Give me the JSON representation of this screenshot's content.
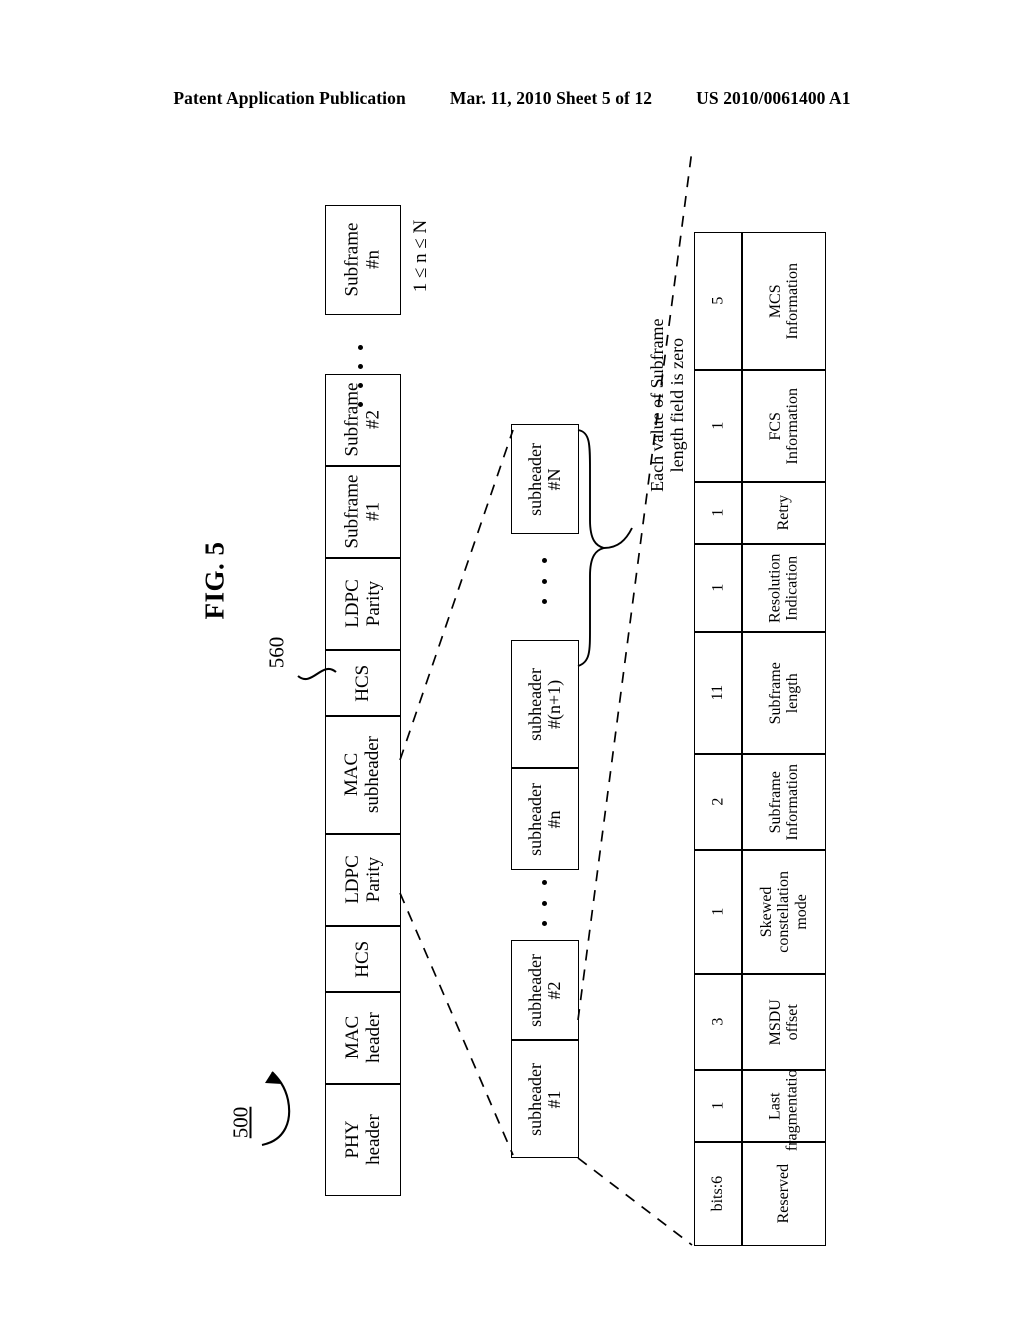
{
  "page_header": {
    "publication": "Patent Application Publication",
    "date_sheet": "Mar. 11, 2010  Sheet 5 of 12",
    "patent_number": "US 2010/0061400 A1"
  },
  "figure": {
    "label": "FIG. 5",
    "ref_frame": "500",
    "ref_subheader": "560",
    "range_note": "1 ≤ n ≤ N",
    "brace_note_line1": "Each value of Subframe",
    "brace_note_line2": "length field is zero",
    "ellipsis_icon": "horizontal-ellipsis"
  },
  "frame_row": {
    "name": "mac-frame-structure",
    "cells": [
      {
        "line1": "PHY",
        "line2": "header"
      },
      {
        "line1": "MAC",
        "line2": "header"
      },
      {
        "line1": "HCS",
        "line2": ""
      },
      {
        "line1": "LDPC",
        "line2": "Parity"
      },
      {
        "line1": "MAC",
        "line2": "subheader"
      },
      {
        "line1": "HCS",
        "line2": ""
      },
      {
        "line1": "LDPC",
        "line2": "Parity"
      },
      {
        "line1": "Subframe",
        "line2": "#1"
      },
      {
        "line1": "Subframe",
        "line2": "#2"
      }
    ],
    "tail_cell": {
      "line1": "Subframe",
      "line2": "#n"
    }
  },
  "subheader_row": {
    "name": "mac-subheader-expansion",
    "cells": [
      {
        "line1": "subheader",
        "line2": "#1"
      },
      {
        "line1": "subheader",
        "line2": "#2"
      }
    ],
    "cells2": [
      {
        "line1": "subheader",
        "line2": "#n"
      },
      {
        "line1": "subheader",
        "line2": "#(n+1)"
      }
    ],
    "tail_cell": {
      "line1": "subheader",
      "line2": "#N"
    }
  },
  "field_table": {
    "name": "subheader-field-table",
    "bits_label": "bits:6",
    "columns": [
      {
        "bits": "1",
        "line1": "Last",
        "line2": "fragmentation",
        "line3": ""
      },
      {
        "bits": "3",
        "line1": "MSDU",
        "line2": "offset",
        "line3": ""
      },
      {
        "bits": "1",
        "line1": "Skewed",
        "line2": "constellation",
        "line3": "mode"
      },
      {
        "bits": "2",
        "line1": "Subframe",
        "line2": "Information",
        "line3": ""
      },
      {
        "bits": "11",
        "line1": "Subframe",
        "line2": "length",
        "line3": ""
      },
      {
        "bits": "1",
        "line1": "Resolution",
        "line2": "Indication",
        "line3": ""
      },
      {
        "bits": "1",
        "line1": "Retry",
        "line2": "",
        "line3": ""
      },
      {
        "bits": "1",
        "line1": "FCS",
        "line2": "Information",
        "line3": ""
      },
      {
        "bits": "5",
        "line1": "MCS",
        "line2": "Information",
        "line3": ""
      }
    ],
    "reserved_label": "Reserved"
  },
  "colors": {
    "ink": "#000000",
    "paper": "#ffffff"
  }
}
